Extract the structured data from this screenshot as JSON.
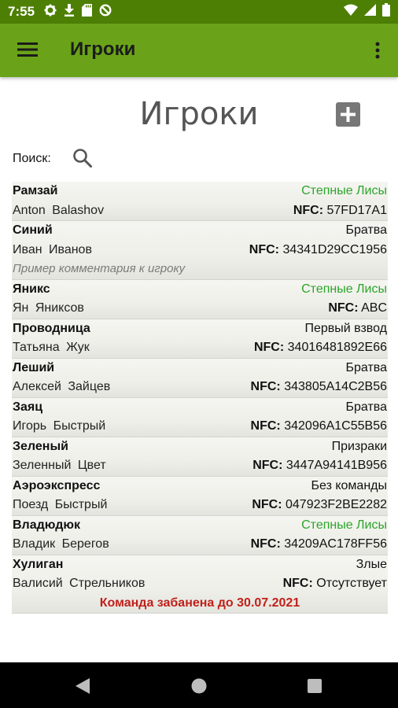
{
  "status_bar": {
    "time": "7:55",
    "left_icons": [
      "gear-icon",
      "download-icon",
      "sd-card-icon",
      "nosign-icon"
    ],
    "right_icons": [
      "wifi-icon",
      "cell-signal-icon",
      "battery-icon"
    ]
  },
  "app_bar": {
    "title": "Игроки",
    "background": "#6aa319"
  },
  "page": {
    "title": "Игроки",
    "search_label": "Поиск:"
  },
  "players": [
    {
      "nick": "Рамзай",
      "team": "Степные Лисы",
      "team_color": "green",
      "name": "Anton Balashov",
      "nfc_label": "NFC:",
      "nfc_value": "57FD17A1"
    },
    {
      "nick": "Синий",
      "team": "Братва",
      "team_color": "black",
      "name": "Иван Иванов",
      "nfc_label": "NFC:",
      "nfc_value": "34341D29CC1956",
      "comment": "Пример комментария к игроку"
    },
    {
      "nick": "Яникс",
      "team": "Степные Лисы",
      "team_color": "green",
      "name": "Ян Яниксов",
      "nfc_label": "NFC:",
      "nfc_value": "ABC"
    },
    {
      "nick": "Проводница",
      "team": "Первый взвод",
      "team_color": "black",
      "name": "Татьяна Жук",
      "nfc_label": "NFC:",
      "nfc_value": "34016481892E66"
    },
    {
      "nick": "Леший",
      "team": "Братва",
      "team_color": "black",
      "name": "Алексей Зайцев",
      "nfc_label": "NFC:",
      "nfc_value": "343805A14C2B56"
    },
    {
      "nick": "Заяц",
      "team": "Братва",
      "team_color": "black",
      "name": "Игорь Быстрый",
      "nfc_label": "NFC:",
      "nfc_value": "342096A1C55B56"
    },
    {
      "nick": "Зеленый",
      "team": "Призраки",
      "team_color": "black",
      "name": "Зеленный Цвет",
      "nfc_label": "NFC:",
      "nfc_value": "3447A94141B956"
    },
    {
      "nick": "Аэроэкспресс",
      "team": "Без команды",
      "team_color": "black",
      "name": "Поезд Быстрый",
      "nfc_label": "NFC:",
      "nfc_value": "047923F2BE2282"
    },
    {
      "nick": "Владюдюк",
      "team": "Степные Лисы",
      "team_color": "green",
      "name": "Владик Берегов",
      "nfc_label": "NFC:",
      "nfc_value": "34209AC178FF56"
    },
    {
      "nick": "Хулиган",
      "team": "Злые",
      "team_color": "black",
      "name": "Валисий Стрельников",
      "nfc_label": "NFC:",
      "nfc_value": "Отсутствует",
      "ban_notice": "Команда забанена до 30.07.2021"
    }
  ],
  "colors": {
    "status_bar": "#4d7f05",
    "app_bar": "#6aa319",
    "team_green": "#2ba52b",
    "ban_red": "#c1201a"
  }
}
